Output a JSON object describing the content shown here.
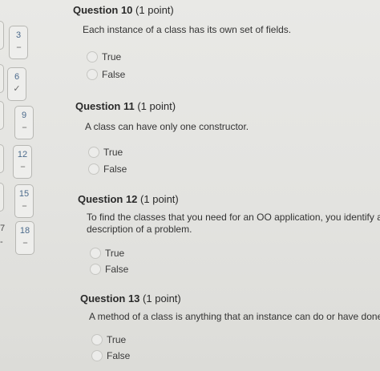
{
  "nav": {
    "tiles": [
      {
        "number": "3",
        "status": "--"
      },
      {
        "number": "6",
        "status": "✓"
      },
      {
        "number": "9",
        "status": "--"
      },
      {
        "number": "12",
        "status": "--"
      },
      {
        "number": "15",
        "status": "--"
      },
      {
        "number": "18",
        "status": "--"
      }
    ],
    "left_fragments": [
      "7",
      "-"
    ]
  },
  "questions": [
    {
      "title": "Question 10",
      "points": "(1 point)",
      "text_lines": [
        "Each instance of a class has its own set of fields."
      ],
      "options": [
        "True",
        "False"
      ]
    },
    {
      "title": "Question 11",
      "points": "(1 point)",
      "text_lines": [
        "A class can have only one constructor."
      ],
      "options": [
        "True",
        "False"
      ]
    },
    {
      "title": "Question 12",
      "points": "(1 point)",
      "text_lines": [
        "To find the classes that you need for an OO application, you identify all",
        "description of a problem."
      ],
      "options": [
        "True",
        "False"
      ]
    },
    {
      "title": "Question 13",
      "points": "(1 point)",
      "text_lines": [
        "A method of a class is anything that an instance can do or have done to i"
      ],
      "options": [
        "True",
        "False"
      ]
    }
  ]
}
